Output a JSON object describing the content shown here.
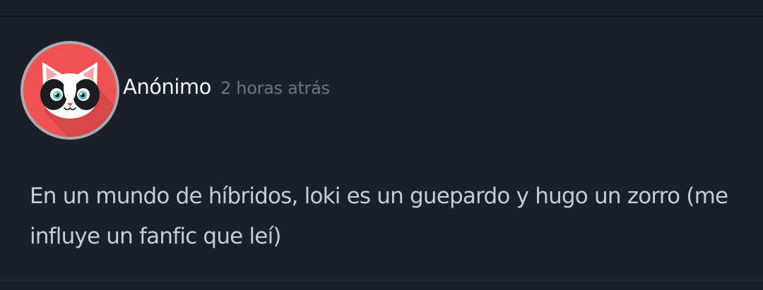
{
  "comment": {
    "author": "Anónimo",
    "timestamp": "2 horas atrás",
    "text": "En un mundo de híbridos, loki es un guepardo y hugo un zorro (me influye un fanfic que leí)",
    "avatar_icon": "cat-face-icon"
  },
  "colors": {
    "background": "#1a1f29",
    "avatar_bg": "#ef5253",
    "author_text": "#f1f2f4",
    "timestamp_text": "#6d7585",
    "body_text": "#c9ccd2"
  }
}
